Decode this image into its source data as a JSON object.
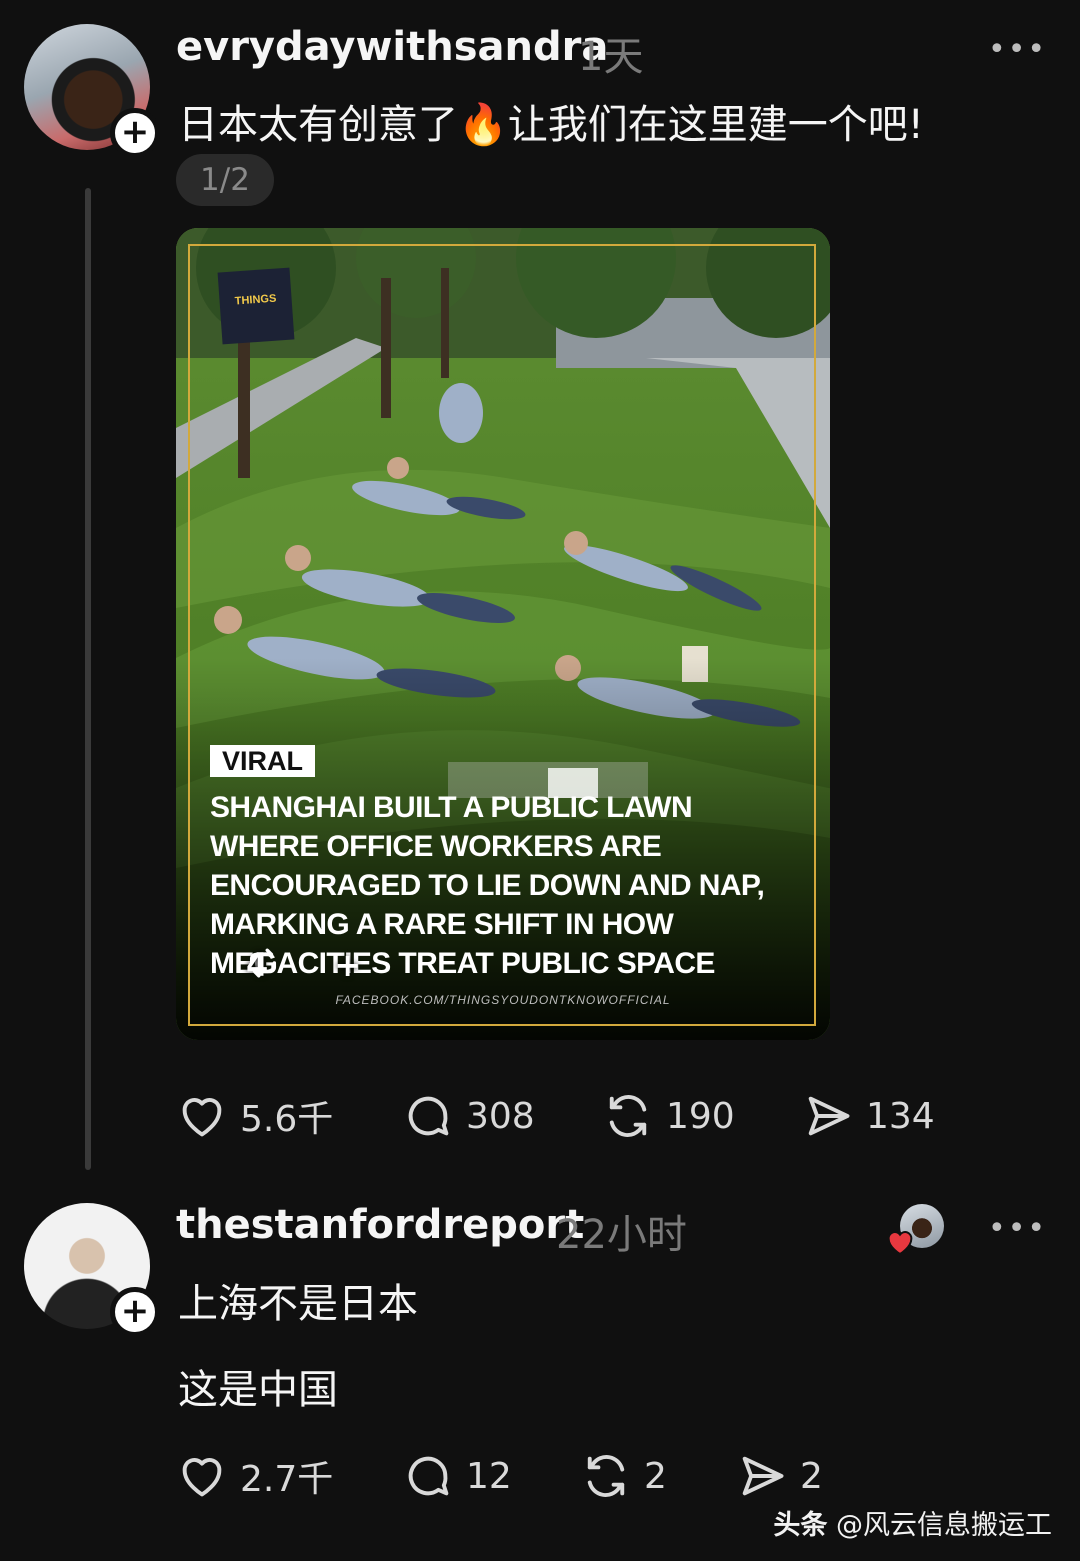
{
  "post": {
    "username": "evrydaywithsandra",
    "time": "1天",
    "more": "•••",
    "text": "日本太有创意了🔥让我们在这里建一个吧!",
    "pager": "1/2",
    "image": {
      "badge": "VIRAL",
      "headline": "SHANGHAI BUILT A PUBLIC LAWN WHERE OFFICE WORKERS ARE ENCOURAGED TO LIE DOWN AND NAP, MARKING A RARE SHIFT IN HOW MEGACITIES TREAT PUBLIC SPACE",
      "source": "FACEBOOK.COM/THINGSYOUDONTKNOWOFFICIAL",
      "logo_text": "THINGS",
      "overlay_repost_count": "4",
      "overlay_plus": "+"
    },
    "actions": {
      "likes": "5.6千",
      "comments": "308",
      "reposts": "190",
      "shares": "134"
    }
  },
  "reply": {
    "username": "thestanfordreport",
    "time": "22小时",
    "more": "•••",
    "line1": "上海不是日本",
    "line2": "这是中国",
    "actions": {
      "likes": "2.7千",
      "comments": "12",
      "reposts": "2",
      "shares": "2"
    }
  },
  "follow_symbol": "+",
  "watermark": {
    "brand": "头条",
    "handle": "@风云信息搬运工"
  },
  "colors": {
    "background": "#101010",
    "text": "#f5f5f5",
    "muted": "#7a7a7a",
    "frame": "#d2a93c",
    "heart": "#e8383f"
  }
}
